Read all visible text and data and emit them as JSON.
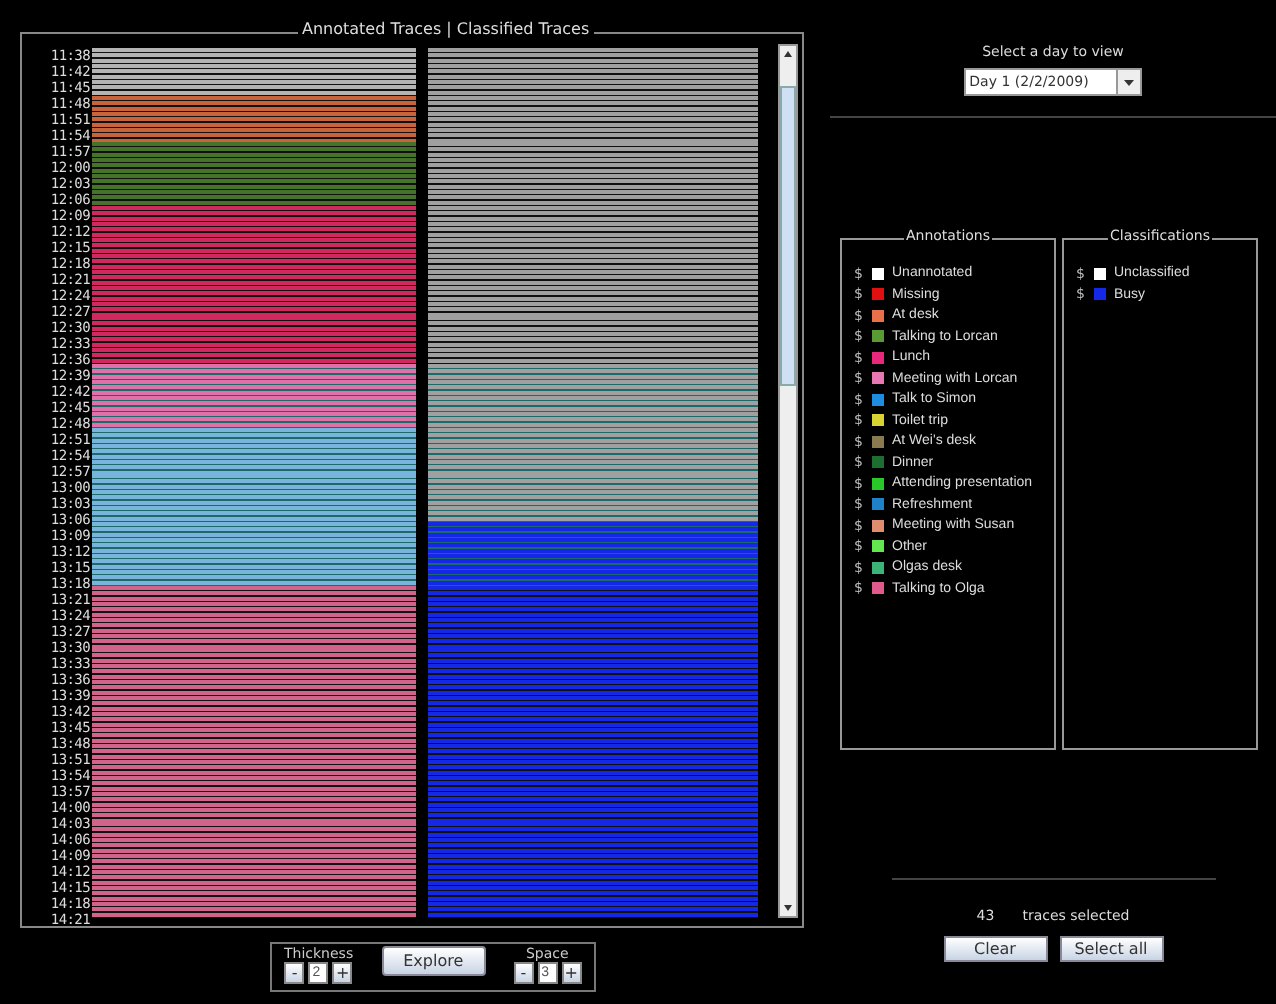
{
  "traces_panel": {
    "title": "Annotated Traces | Classified Traces",
    "rows": [
      {
        "time": "11:38",
        "color": "#b4b4b4",
        "kind": "unclassified",
        "selected": false
      },
      {
        "time": "11:42",
        "color": "#b4b4b4",
        "kind": "unclassified",
        "selected": false
      },
      {
        "time": "11:45",
        "color": "#b4b4b4",
        "kind": "unclassified",
        "selected": false
      },
      {
        "time": "11:48",
        "color": "#c8643c",
        "kind": "unclassified",
        "selected": false
      },
      {
        "time": "11:51",
        "color": "#c8643c",
        "kind": "unclassified",
        "selected": false
      },
      {
        "time": "11:54",
        "color": "#c8643c",
        "kind": "unclassified",
        "selected": false
      },
      {
        "time": "11:57",
        "color": "#46732a",
        "kind": "unclassified",
        "selected": false
      },
      {
        "time": "12:00",
        "color": "#46732a",
        "kind": "unclassified",
        "selected": false
      },
      {
        "time": "12:03",
        "color": "#46732a",
        "kind": "unclassified",
        "selected": false
      },
      {
        "time": "12:06",
        "color": "#46732a",
        "kind": "unclassified",
        "selected": false
      },
      {
        "time": "12:09",
        "color": "#d2285f",
        "kind": "unclassified",
        "selected": false
      },
      {
        "time": "12:12",
        "color": "#d2285f",
        "kind": "unclassified",
        "selected": false
      },
      {
        "time": "12:15",
        "color": "#d2285f",
        "kind": "unclassified",
        "selected": false
      },
      {
        "time": "12:18",
        "color": "#d2285f",
        "kind": "unclassified",
        "selected": false
      },
      {
        "time": "12:21",
        "color": "#d2285f",
        "kind": "unclassified",
        "selected": false
      },
      {
        "time": "12:24",
        "color": "#d2285f",
        "kind": "unclassified",
        "selected": false
      },
      {
        "time": "12:27",
        "color": "#d2285f",
        "kind": "unclassified",
        "selected": false
      },
      {
        "time": "12:30",
        "color": "#d2285f",
        "kind": "unclassified",
        "selected": false
      },
      {
        "time": "12:33",
        "color": "#d2285f",
        "kind": "unclassified",
        "selected": false
      },
      {
        "time": "12:36",
        "color": "#d2285f",
        "kind": "unclassified",
        "selected": false
      },
      {
        "time": "12:39",
        "color": "#e070a8",
        "kind": "unclassified",
        "selected": true
      },
      {
        "time": "12:42",
        "color": "#e070a8",
        "kind": "unclassified",
        "selected": true
      },
      {
        "time": "12:45",
        "color": "#e070a8",
        "kind": "unclassified",
        "selected": true
      },
      {
        "time": "12:48",
        "color": "#e070a8",
        "kind": "unclassified",
        "selected": true
      },
      {
        "time": "12:51",
        "color": "#78b4dc",
        "kind": "unclassified",
        "selected": true
      },
      {
        "time": "12:54",
        "color": "#78b4dc",
        "kind": "unclassified",
        "selected": true
      },
      {
        "time": "12:57",
        "color": "#78b4dc",
        "kind": "unclassified",
        "selected": true
      },
      {
        "time": "13:00",
        "color": "#78b4dc",
        "kind": "unclassified",
        "selected": true
      },
      {
        "time": "13:03",
        "color": "#78b4dc",
        "kind": "unclassified",
        "selected": true
      },
      {
        "time": "13:06",
        "color": "#78b4dc",
        "kind": "unclassified",
        "selected": true
      },
      {
        "time": "13:09",
        "color": "#78b4dc",
        "kind": "busy",
        "selected": true
      },
      {
        "time": "13:12",
        "color": "#78b4dc",
        "kind": "busy",
        "selected": true
      },
      {
        "time": "13:15",
        "color": "#78b4dc",
        "kind": "busy",
        "selected": true
      },
      {
        "time": "13:18",
        "color": "#78b4dc",
        "kind": "busy",
        "selected": true
      },
      {
        "time": "13:21",
        "color": "#d2648c",
        "kind": "busy",
        "selected": false
      },
      {
        "time": "13:24",
        "color": "#d2648c",
        "kind": "busy",
        "selected": false
      },
      {
        "time": "13:27",
        "color": "#d2648c",
        "kind": "busy",
        "selected": false
      },
      {
        "time": "13:30",
        "color": "#d2648c",
        "kind": "busy",
        "selected": false
      },
      {
        "time": "13:33",
        "color": "#d2648c",
        "kind": "busy",
        "selected": false
      },
      {
        "time": "13:36",
        "color": "#d2648c",
        "kind": "busy",
        "selected": false
      },
      {
        "time": "13:39",
        "color": "#d2648c",
        "kind": "busy",
        "selected": false
      },
      {
        "time": "13:42",
        "color": "#d2648c",
        "kind": "busy",
        "selected": false
      },
      {
        "time": "13:45",
        "color": "#d2648c",
        "kind": "busy",
        "selected": false
      },
      {
        "time": "13:48",
        "color": "#d2648c",
        "kind": "busy",
        "selected": false
      },
      {
        "time": "13:51",
        "color": "#d2648c",
        "kind": "busy",
        "selected": false
      },
      {
        "time": "13:54",
        "color": "#d2648c",
        "kind": "busy",
        "selected": false
      },
      {
        "time": "13:57",
        "color": "#d2648c",
        "kind": "busy",
        "selected": false
      },
      {
        "time": "14:00",
        "color": "#d2648c",
        "kind": "busy",
        "selected": false
      },
      {
        "time": "14:03",
        "color": "#d2648c",
        "kind": "busy",
        "selected": false
      },
      {
        "time": "14:06",
        "color": "#d2648c",
        "kind": "busy",
        "selected": false
      },
      {
        "time": "14:09",
        "color": "#d2648c",
        "kind": "busy",
        "selected": false
      },
      {
        "time": "14:12",
        "color": "#d2648c",
        "kind": "busy",
        "selected": false
      },
      {
        "time": "14:15",
        "color": "#d2648c",
        "kind": "busy",
        "selected": false
      },
      {
        "time": "14:18",
        "color": "#d2648c",
        "kind": "busy",
        "selected": false
      },
      {
        "time": "14:21",
        "color": "#d2648c",
        "kind": "busy",
        "selected": false
      }
    ]
  },
  "controls": {
    "thickness": {
      "label": "Thickness",
      "minus": "-",
      "value": "2",
      "plus": "+"
    },
    "explore": "Explore",
    "space": {
      "label": "Space",
      "minus": "-",
      "value": "3",
      "plus": "+"
    }
  },
  "day_picker": {
    "label": "Select a day to view",
    "value": "Day 1 (2/2/2009)"
  },
  "annotations": {
    "title": "Annotations",
    "items": [
      {
        "marker": "$",
        "color": "#ffffff",
        "label": "Unannotated"
      },
      {
        "marker": "$",
        "color": "#e01010",
        "label": "Missing"
      },
      {
        "marker": "$",
        "color": "#e8704a",
        "label": "At desk"
      },
      {
        "marker": "$",
        "color": "#5a9a32",
        "label": "Talking to Lorcan"
      },
      {
        "marker": "$",
        "color": "#e8287a",
        "label": "Lunch"
      },
      {
        "marker": "$",
        "color": "#e878b4",
        "label": "Meeting with Lorcan"
      },
      {
        "marker": "$",
        "color": "#1e8ce0",
        "label": "Talk to Simon"
      },
      {
        "marker": "$",
        "color": "#d8d232",
        "label": "Toilet trip"
      },
      {
        "marker": "$",
        "color": "#8a7a50",
        "label": "At Wei's desk"
      },
      {
        "marker": "$",
        "color": "#1e6e32",
        "label": "Dinner"
      },
      {
        "marker": "$",
        "color": "#28c828",
        "label": "Attending presentation"
      },
      {
        "marker": "$",
        "color": "#1e82c8",
        "label": "Refreshment"
      },
      {
        "marker": "$",
        "color": "#e08c6e",
        "label": "Meeting with Susan"
      },
      {
        "marker": "$",
        "color": "#64e650",
        "label": "Other"
      },
      {
        "marker": "$",
        "color": "#3cb478",
        "label": "Olgas desk"
      },
      {
        "marker": "$",
        "color": "#e05a8c",
        "label": "Talking to Olga"
      }
    ]
  },
  "classifications": {
    "title": "Classifications",
    "items": [
      {
        "marker": "$",
        "color": "#ffffff",
        "label": "Unclassified",
        "kind": "unclassified"
      },
      {
        "marker": "$",
        "color": "#1428e6",
        "label": "Busy",
        "kind": "busy"
      }
    ]
  },
  "selection": {
    "count": "43",
    "label": "traces selected",
    "buttons": [
      "Clear",
      "Select all"
    ]
  }
}
